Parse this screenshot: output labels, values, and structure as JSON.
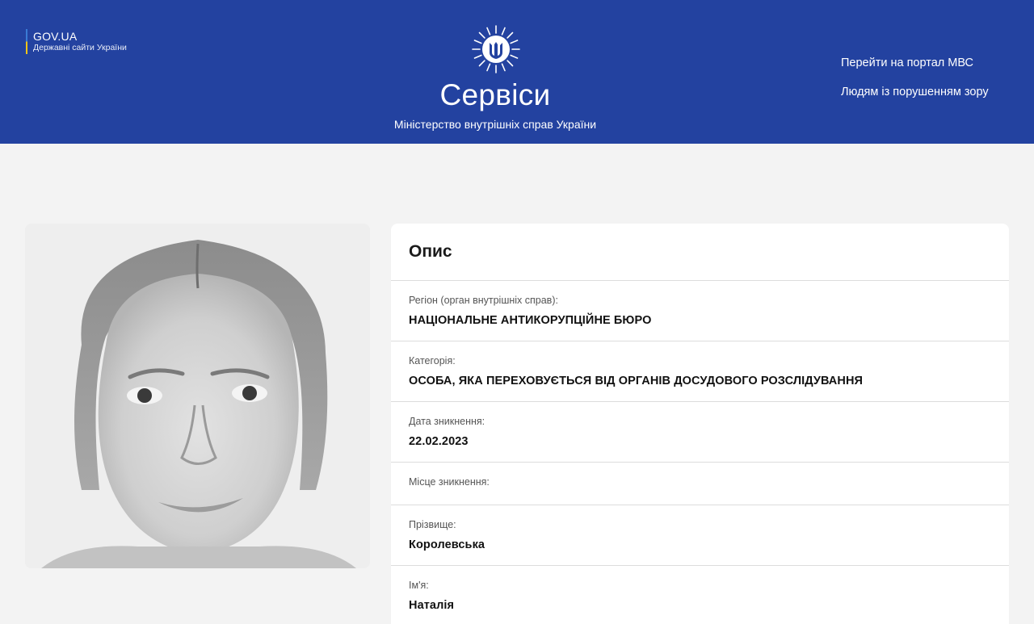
{
  "header": {
    "gov_title": "GOV.UA",
    "gov_subtitle": "Державні сайти України",
    "brand_title": "Сервіси",
    "brand_subtitle": "Міністерство внутрішніх справ України",
    "links": [
      "Перейти на портал МВС",
      "Людям із порушенням зору"
    ],
    "brand_color": "#2342a0"
  },
  "description": {
    "title": "Опис",
    "fields": [
      {
        "label": "Регіон (орган внутрішніх справ):",
        "value": "НАЦІОНАЛЬНЕ АНТИКОРУПЦІЙНЕ БЮРО"
      },
      {
        "label": "Категорія:",
        "value": "ОСОБА, ЯКА ПЕРЕХОВУЄТЬСЯ ВІД ОРГАНІВ ДОСУДОВОГО РОЗСЛІДУВАННЯ"
      },
      {
        "label": "Дата зникнення:",
        "value": "22.02.2023"
      },
      {
        "label": "Місце зникнення:",
        "value": ""
      },
      {
        "label": "Прізвище:",
        "value": "Королевська"
      },
      {
        "label": "Ім'я:",
        "value": "Наталія"
      }
    ]
  },
  "icons": {
    "emblem": "trident-emblem-icon"
  }
}
